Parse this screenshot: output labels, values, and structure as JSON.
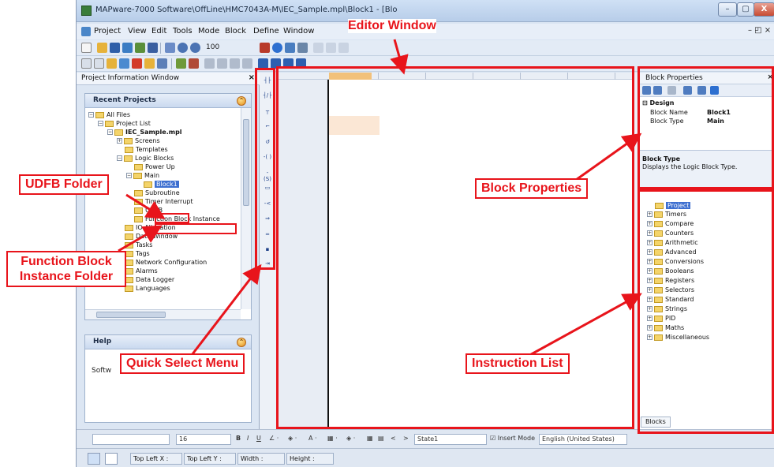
{
  "window": {
    "title": "MAPware-7000 Software\\OffLine\\HMC7043A-M\\IEC_Sample.mpl\\Block1 - [Blo",
    "controls": {
      "minimize": "–",
      "maximize": "▢",
      "close": "X"
    }
  },
  "menu": {
    "items": [
      "Project",
      "View",
      "Edit",
      "Tools",
      "Mode",
      "Block",
      "Define",
      "Window"
    ],
    "right_controls": "– ◰ ×"
  },
  "toolbar": {
    "zoom_value": "100"
  },
  "project_panel": {
    "header": "Project Information Window",
    "close": "×",
    "recent_projects": {
      "title": "Recent Projects",
      "tree": [
        {
          "label": "All Files"
        },
        {
          "label": "Project List"
        },
        {
          "label": "IEC_Sample.mpl"
        },
        {
          "label": "Screens"
        },
        {
          "label": "Templates"
        },
        {
          "label": "Logic Blocks"
        },
        {
          "label": "Power Up"
        },
        {
          "label": "Main"
        },
        {
          "label": "Block1"
        },
        {
          "label": "Subroutine"
        },
        {
          "label": "Timer Interrupt"
        },
        {
          "label": "UDFB"
        },
        {
          "label": "Function Block Instance"
        },
        {
          "label": "IO Allocation"
        },
        {
          "label": "Data Window"
        },
        {
          "label": "Tasks"
        },
        {
          "label": "Tags"
        },
        {
          "label": "Network Configuration"
        },
        {
          "label": "Alarms"
        },
        {
          "label": "Data Logger"
        },
        {
          "label": "Languages"
        }
      ]
    },
    "help": {
      "title": "Help",
      "body": "Softw"
    }
  },
  "block_properties": {
    "header": "Block Properties",
    "close": "×",
    "section": "Design",
    "rows": [
      {
        "name": "Block Name",
        "value": "Block1"
      },
      {
        "name": "Block Type",
        "value": "Main"
      }
    ],
    "desc_title": "Block Type",
    "desc_text": "Displays the Logic Block Type."
  },
  "instruction_list": {
    "items": [
      "Project",
      "Timers",
      "Compare",
      "Counters",
      "Arithmetic",
      "Advanced",
      "Conversions",
      "Booleans",
      "Registers",
      "Selectors",
      "Standard",
      "Strings",
      "PID",
      "Maths",
      "Miscellaneous"
    ],
    "tab": "Blocks"
  },
  "format_bar": {
    "font_size": "16",
    "state": "State1",
    "insert_mode": "Insert Mode",
    "language": "English (United States)"
  },
  "status_bar": {
    "top_left_x": "Top Left X :",
    "top_left_y": "Top Left Y :",
    "width": "Width :",
    "height": "Height :"
  },
  "annotations": {
    "editor_window": "Editor Window",
    "udfb_folder": "UDFB Folder",
    "function_block_instance_folder_line1": "Function Block",
    "function_block_instance_folder_line2": "Instance Folder",
    "quick_select_menu": "Quick Select Menu",
    "block_properties": "Block Properties",
    "instruction_list": "Instruction List"
  },
  "colors": {
    "annotation_red": "#e8141b",
    "selection_blue": "#3d6fd0",
    "folder_yellow": "#f4d46a"
  }
}
